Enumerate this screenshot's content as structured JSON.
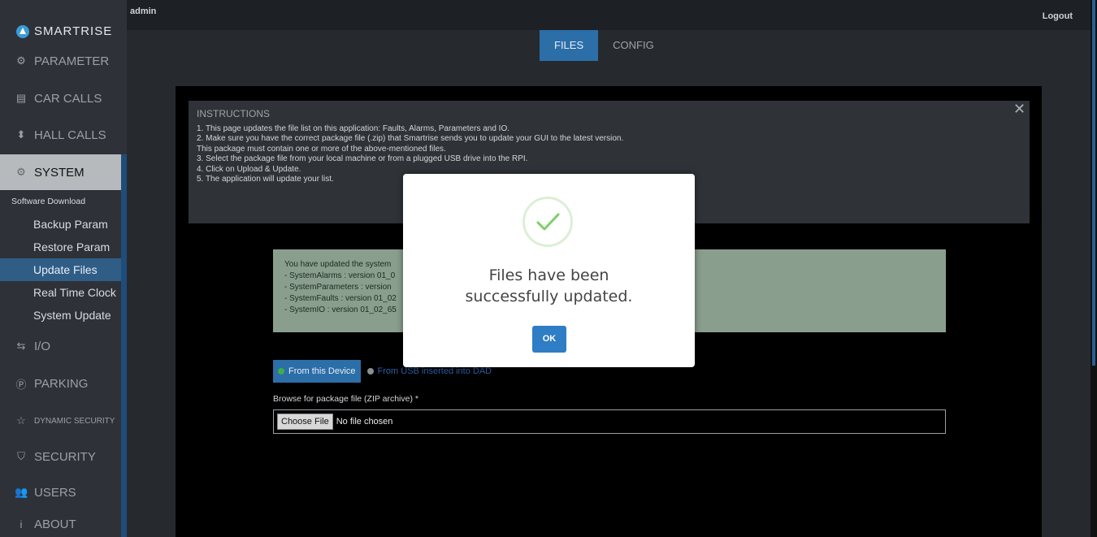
{
  "header": {
    "user": "admin",
    "logout_label": "Logout"
  },
  "brand": {
    "name": "SMARTRISE"
  },
  "sidebar": {
    "items": [
      {
        "label": "PARAMETER",
        "icon": "parameter-icon"
      },
      {
        "label": "CAR CALLS",
        "icon": "car-calls-icon"
      },
      {
        "label": "HALL CALLS",
        "icon": "hall-calls-icon"
      },
      {
        "label": "SYSTEM",
        "icon": "gear-icon"
      },
      {
        "label": "I/O",
        "icon": "io-icon"
      },
      {
        "label": "PARKING",
        "icon": "parking-icon"
      },
      {
        "label": "DYNAMIC SECURITY",
        "icon": "star-icon"
      },
      {
        "label": "SECURITY",
        "icon": "shield-icon"
      },
      {
        "label": "USERS",
        "icon": "users-icon"
      },
      {
        "label": "ABOUT",
        "icon": "info-icon"
      }
    ],
    "system_subitems": [
      "Software Download",
      "Backup Param",
      "Restore Param",
      "Update Files",
      "Real Time Clock",
      "System Update"
    ]
  },
  "tabs": [
    {
      "label": "FILES"
    },
    {
      "label": "CONFIG"
    }
  ],
  "instructions": {
    "title": "INSTRUCTIONS",
    "lines": [
      "1. This page updates the file list on this application: Faults, Alarms, Parameters and IO.",
      "2. Make sure you have the correct package file (.zip) that Smartrise sends you to update your GUI to the latest version.",
      "This package must contain one or more of the above-mentioned files.",
      "3. Select the package file from your local machine or from a plugged USB drive into the RPI.",
      "4. Click on Upload & Update.",
      "5. The application will update your list."
    ]
  },
  "success": {
    "lines": [
      "You have updated the system",
      "- SystemAlarms : version 01_0",
      "- SystemParameters : version",
      "- SystemFaults : version 01_02",
      "- SystemIO : version 01_02_65"
    ]
  },
  "source": {
    "device_label": "From this Device",
    "usb_label": "From USB inserted into DAD"
  },
  "upload": {
    "browse_label": "Browse for package file (ZIP archive) *",
    "choose_label": "Choose File",
    "no_file_label": "No file chosen"
  },
  "modal": {
    "message": "Files have been successfully updated.",
    "ok_label": "OK",
    "icon": "check-icon"
  },
  "colors": {
    "accent": "#2b6ea8",
    "success_bg": "#8a9e8d",
    "check_green": "#7ccf6a"
  }
}
